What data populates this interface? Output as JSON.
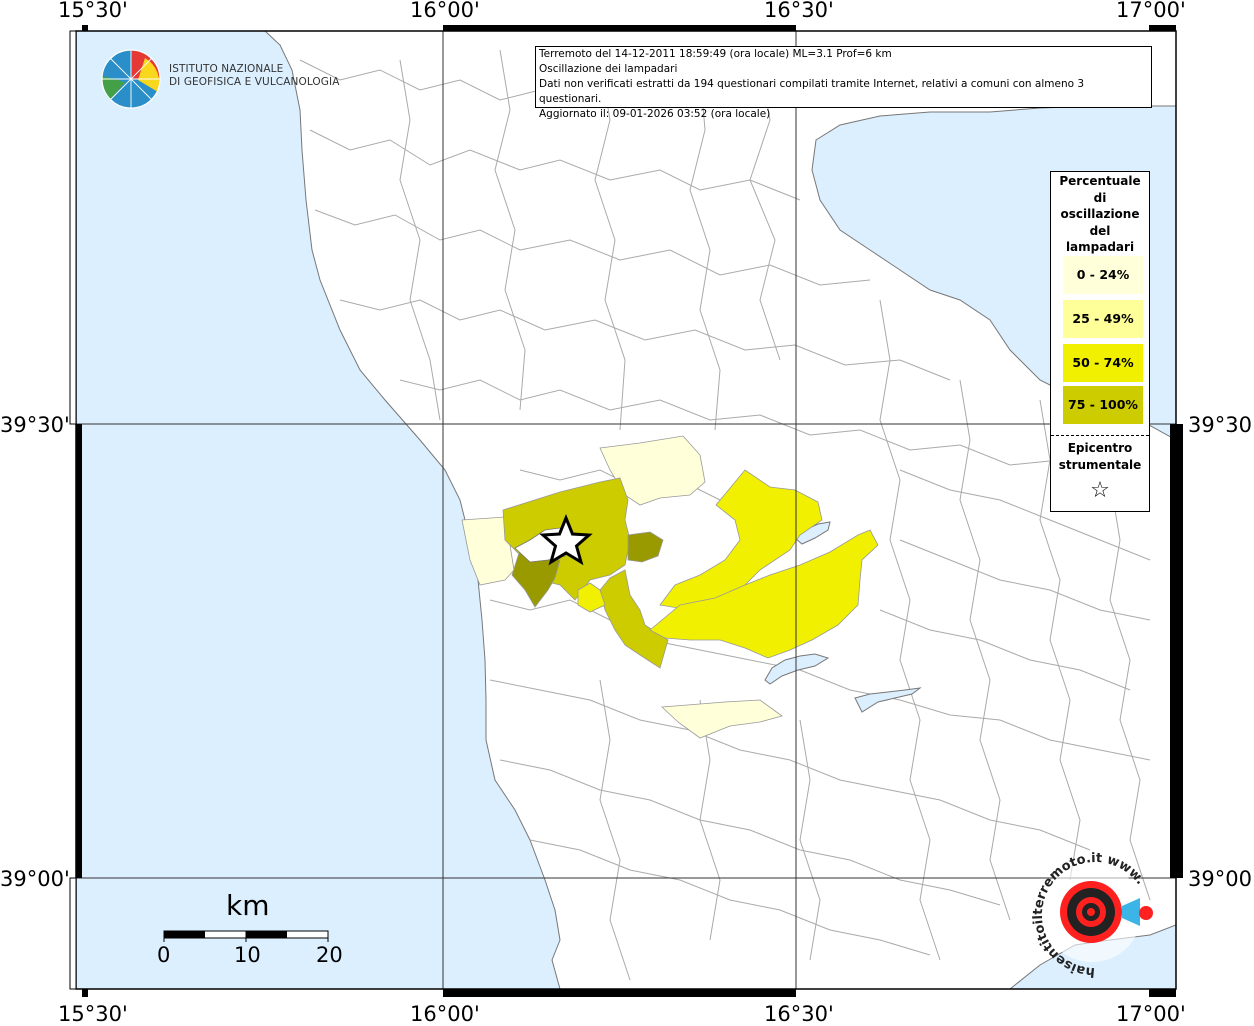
{
  "title_box": {
    "line1": "Terremoto del 14-12-2011 18:59:49 (ora locale) ML=3.1 Prof=6 km",
    "line2": "Oscillazione dei lampadari",
    "line3": "Dati non verificati estratti da 194 questionari compilati tramite Internet, relativi a comuni con almeno 3 questionari.",
    "line4": "Aggiornato il: 09-01-2026 03:52 (ora locale)"
  },
  "institute": {
    "line1": "ISTITUTO NAZIONALE",
    "line2": "DI GEOFISICA E VULCANOLOGIA"
  },
  "legend": {
    "header": [
      "Percentuale",
      "di",
      "oscillazione",
      "del",
      "lampadari"
    ],
    "classes": [
      {
        "label": "0 - 24%",
        "color": "#ffffd9"
      },
      {
        "label": "25 - 49%",
        "color": "#ffff99"
      },
      {
        "label": "50 - 74%",
        "color": "#f0f000"
      },
      {
        "label": "75 - 100%",
        "color": "#cccc00"
      }
    ],
    "epicenter_title": [
      "Epicentro",
      "strumentale"
    ],
    "epicenter_symbol": "☆"
  },
  "axes": {
    "top_longitudes": [
      "15°30'",
      "16°00'",
      "16°30'",
      "17°00'"
    ],
    "bottom_longitudes": [
      "15°30'",
      "16°00'",
      "16°30'",
      "17°00'"
    ],
    "left_latitudes": [
      "39°30'",
      "39°00'"
    ],
    "right_latitudes": [
      "39°30'",
      "39°00'"
    ]
  },
  "scale_bar": {
    "unit": "km",
    "ticks": [
      "0",
      "10",
      "20"
    ]
  },
  "badge": {
    "text": "haisentitoilterremoto.it  www."
  },
  "colors": {
    "sea": "#dcefff",
    "land": "#ffffff",
    "boundary": "#aaaaaa",
    "grid": "#333333",
    "dark_class": "#999900"
  }
}
